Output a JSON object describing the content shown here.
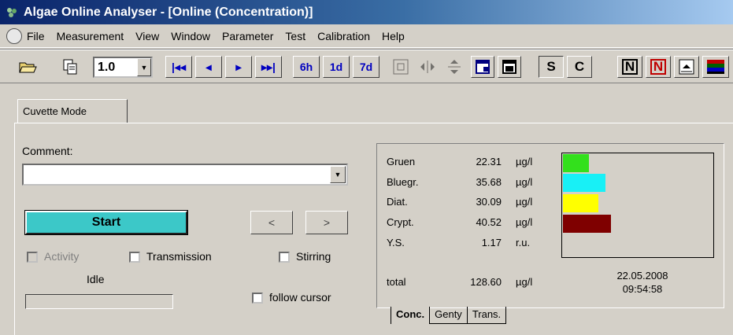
{
  "window": {
    "title": "Algae Online Analyser - [Online (Concentration)]"
  },
  "menu": [
    "File",
    "Measurement",
    "View",
    "Window",
    "Parameter",
    "Test",
    "Calibration",
    "Help"
  ],
  "toolbar": {
    "zoom_value": "1.0",
    "nav": [
      "|◂◂",
      "◂",
      "▸",
      "▸▸|"
    ],
    "ranges": [
      "6h",
      "1d",
      "7d"
    ],
    "s_label": "S",
    "c_label": "C",
    "n_label": "N"
  },
  "tab": {
    "label": "Cuvette Mode"
  },
  "form": {
    "comment_label": "Comment:",
    "comment_value": "",
    "start_label": "Start",
    "prev_label": "<",
    "next_label": ">",
    "activity_label": "Activity",
    "transmission_label": "Transmission",
    "stirring_label": "Stirring",
    "status": "Idle",
    "follow_label": "follow cursor"
  },
  "readings": [
    {
      "name": "Gruen",
      "value": "22.31",
      "unit": "µg/l",
      "color": "#33e01c",
      "level": 22.31
    },
    {
      "name": "Bluegr.",
      "value": "35.68",
      "unit": "µg/l",
      "color": "#18f0f6",
      "level": 35.68
    },
    {
      "name": "Diat.",
      "value": "30.09",
      "unit": "µg/l",
      "color": "#ffff00",
      "level": 30.09
    },
    {
      "name": "Crypt.",
      "value": "40.52",
      "unit": "µg/l",
      "color": "#7f0000",
      "level": 40.52
    },
    {
      "name": "Y.S.",
      "value": "1.17",
      "unit": "r.u.",
      "color": "#d4d0c8",
      "level": 0
    }
  ],
  "total": {
    "name": "total",
    "value": "128.60",
    "unit": "µg/l"
  },
  "timestamp": {
    "date": "22.05.2008",
    "time": "09:54:58"
  },
  "bottom_tabs": [
    "Conc.",
    "Genty",
    "Trans."
  ]
}
